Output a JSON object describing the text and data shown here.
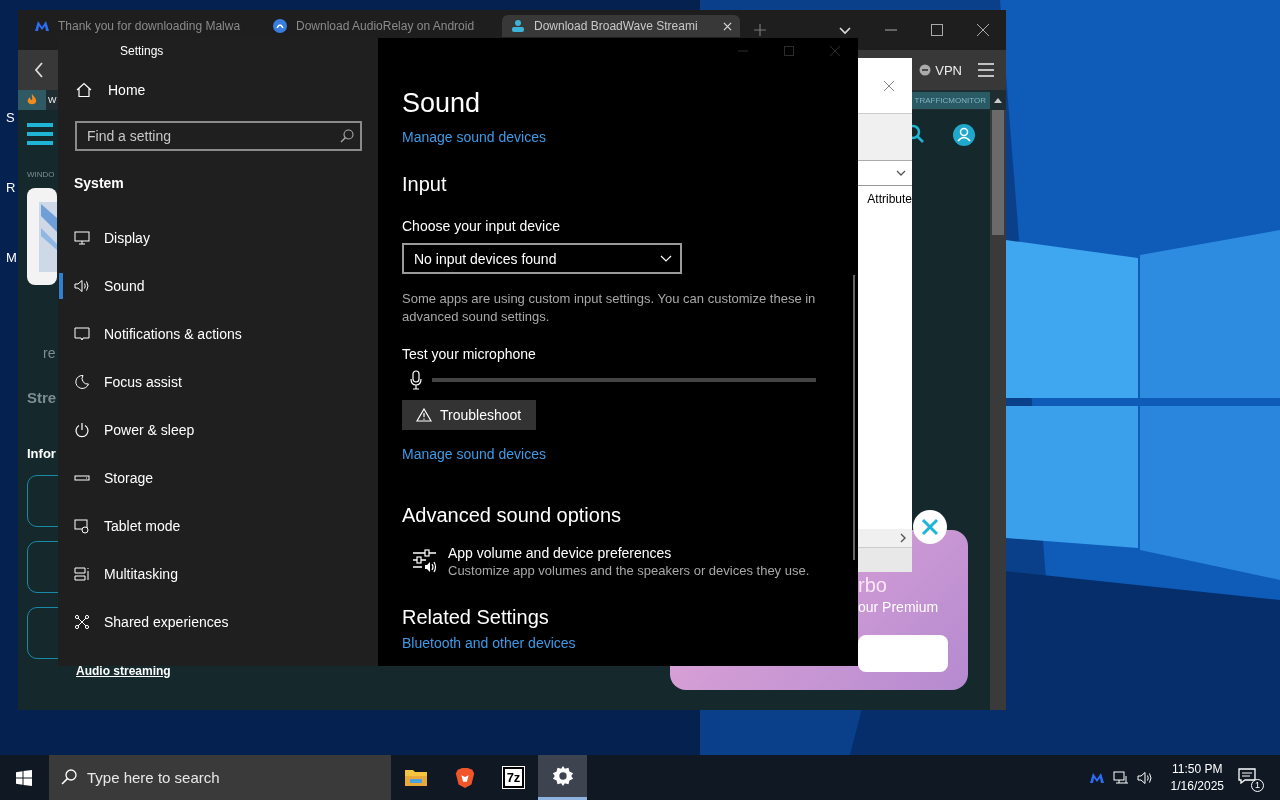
{
  "desktop": {
    "icon_labels": [
      "S",
      "R",
      "M"
    ]
  },
  "browser": {
    "tabs": [
      {
        "title": "Thank you for downloading Malwa",
        "kind": "malware",
        "selected": false
      },
      {
        "title": "Download AudioRelay on Android",
        "kind": "relay",
        "selected": false
      },
      {
        "title": "Download BroadWave Streami",
        "kind": "broadwave",
        "selected": true
      }
    ],
    "vpn": "VPN",
    "bookmark_cut": "W",
    "bookmark_label": "TRAFFICMONITOR",
    "page": {
      "section_label": "WINDO",
      "cut_texts": [
        "re",
        "Stre",
        "Infor"
      ],
      "link": "Audio streaming",
      "popup_column": "Attribute",
      "promo_lines": [
        "rbo",
        "our Premium"
      ]
    }
  },
  "settings": {
    "window_title": "Settings",
    "home": "Home",
    "search": {
      "placeholder": "Find a setting"
    },
    "group": "System",
    "nav": [
      {
        "label": "Display",
        "kind": "display",
        "selected": false
      },
      {
        "label": "Sound",
        "kind": "sound",
        "selected": true
      },
      {
        "label": "Notifications & actions",
        "kind": "notifications",
        "selected": false
      },
      {
        "label": "Focus assist",
        "kind": "focus",
        "selected": false
      },
      {
        "label": "Power & sleep",
        "kind": "power",
        "selected": false
      },
      {
        "label": "Storage",
        "kind": "storage",
        "selected": false
      },
      {
        "label": "Tablet mode",
        "kind": "tablet",
        "selected": false
      },
      {
        "label": "Multitasking",
        "kind": "multitasking",
        "selected": false
      },
      {
        "label": "Shared experiences",
        "kind": "shared",
        "selected": false
      }
    ],
    "page_title": "Sound",
    "top_link": "Manage sound devices",
    "input_heading": "Input",
    "device_label": "Choose your input device",
    "device_value": "No input devices found",
    "note": "Some apps are using custom input settings. You can customize these in advanced sound settings.",
    "test_label": "Test your microphone",
    "mic_meter": {
      "level": 0
    },
    "troubleshoot": "Troubleshoot",
    "manage_link": "Manage sound devices",
    "advanced_heading": "Advanced sound options",
    "app_pref": {
      "title": "App volume and device preferences",
      "subtitle": "Customize app volumes and the speakers or devices they use."
    },
    "related_heading": "Related Settings",
    "related_link": "Bluetooth and other devices"
  },
  "taskbar": {
    "search_placeholder": "Type here to search",
    "apps": [
      {
        "kind": "folder",
        "selected": false
      },
      {
        "kind": "lion",
        "selected": false
      },
      {
        "kind": "archive",
        "label": "7z",
        "selected": false
      },
      {
        "kind": "gear",
        "selected": true
      }
    ],
    "time": "11:50 PM",
    "date": "1/16/2025",
    "notification_count": "1"
  }
}
